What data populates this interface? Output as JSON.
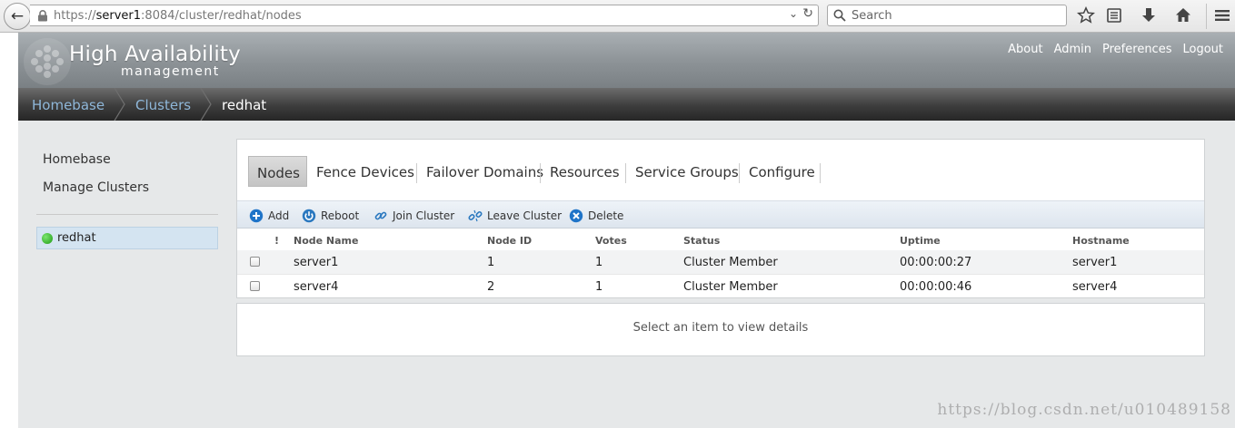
{
  "browser": {
    "url_scheme": "https://",
    "url_host": "server1",
    "url_rest": ":8084/cluster/redhat/nodes",
    "search_placeholder": "Search"
  },
  "app": {
    "title": "High Availability",
    "subtitle": "management",
    "top_nav": [
      "About",
      "Admin",
      "Preferences",
      "Logout"
    ]
  },
  "breadcrumb": [
    "Homebase",
    "Clusters",
    "redhat"
  ],
  "sidebar": {
    "links": [
      "Homebase",
      "Manage Clusters"
    ],
    "clusters": [
      {
        "name": "redhat",
        "status_color": "#2fb523"
      }
    ]
  },
  "tabs": [
    "Nodes",
    "Fence Devices",
    "Failover Domains",
    "Resources",
    "Service Groups",
    "Configure"
  ],
  "actions": [
    "Add",
    "Reboot",
    "Join Cluster",
    "Leave Cluster",
    "Delete"
  ],
  "table": {
    "flag_header": "!",
    "columns": [
      "Node Name",
      "Node ID",
      "Votes",
      "Status",
      "Uptime",
      "Hostname"
    ],
    "rows": [
      [
        "server1",
        "1",
        "1",
        "Cluster Member",
        "00:00:00:27",
        "server1"
      ],
      [
        "server4",
        "2",
        "1",
        "Cluster Member",
        "00:00:00:46",
        "server4"
      ]
    ]
  },
  "details": {
    "placeholder": "Select an item to view details"
  },
  "watermark": "https://blog.csdn.net/u010489158",
  "colors": {
    "accent": "#8fb7d9",
    "selected": "#d4e4f1",
    "breadcrumb_dark": "#262626"
  }
}
